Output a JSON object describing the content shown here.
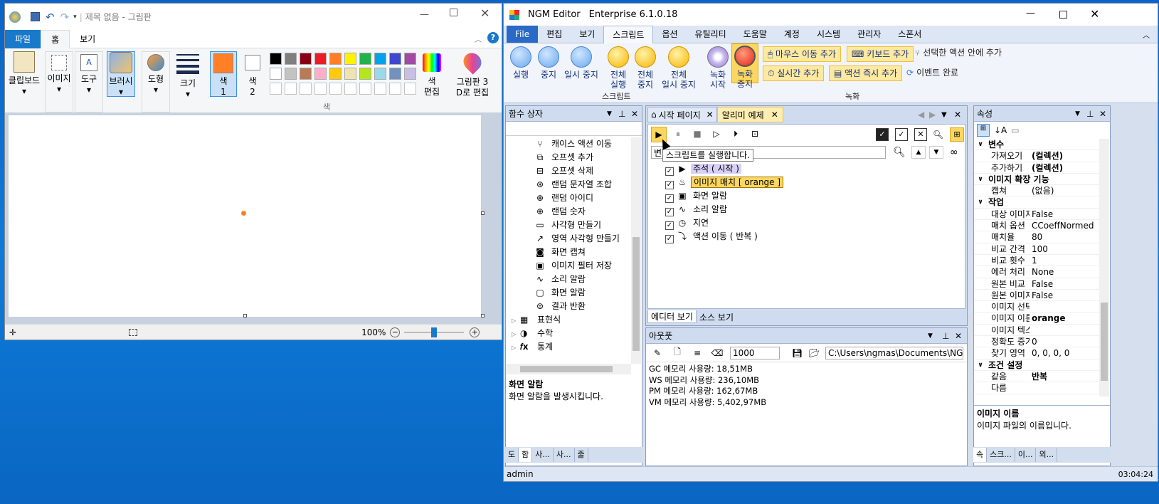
{
  "paint": {
    "title": "제목 없음 - 그림판",
    "tabs": [
      "파일",
      "홈",
      "보기"
    ],
    "groups": {
      "clipboard": "클립보드",
      "image": "이미지",
      "tools": "도구",
      "brushes": "브러시",
      "shapes": "도형",
      "size": "크기",
      "color1": "색",
      "color1_sub": "1",
      "color2": "색",
      "color2_sub": "2",
      "edit_colors": "색",
      "edit_colors_sub": "편집",
      "paint3d": "그림판 3",
      "paint3d_sub": "D로 편집",
      "colors_label": "색"
    },
    "palette_row1": [
      "#000000",
      "#7f7f7f",
      "#880015",
      "#ed1c24",
      "#ff7f27",
      "#fff200",
      "#22b14c",
      "#00a2e8",
      "#3f48cc",
      "#a349a4"
    ],
    "palette_row2": [
      "#ffffff",
      "#c3c3c3",
      "#b97a57",
      "#ffaec9",
      "#ffc90e",
      "#efe4b0",
      "#b5e61d",
      "#99d9ea",
      "#7092be",
      "#c8bfe7"
    ],
    "color1_value": "#ff7f27",
    "zoom": "100%"
  },
  "ngm": {
    "title": "NGM Editor",
    "edition": "Enterprise 6.1.0.18",
    "menu": [
      "File",
      "편집",
      "보기",
      "스크립트",
      "옵션",
      "유틸리티",
      "도움말",
      "계정",
      "시스템",
      "관리자",
      "스폰서"
    ],
    "ribbon": {
      "run": "실행",
      "stop": "중지",
      "pause": "일시 중지",
      "run_all": "전체",
      "run_all_sub": "실행",
      "stop_all": "전체",
      "stop_all_sub": "중지",
      "pause_all": "전체",
      "pause_all_sub": "일시 중지",
      "rec_start": "녹화",
      "rec_start_sub": "시작",
      "rec_stop": "녹화",
      "rec_stop_sub": "중지",
      "mouse_add": "마우스 이동 추가",
      "kbd_add": "키보드 추가",
      "sel_action_add": "선택한 액션 안에 추가",
      "realtime_add": "실시간 추가",
      "immediate_add": "액션 즉시 추가",
      "event_done": "이벤트 완료",
      "group_script": "스크립트",
      "group_record": "녹화"
    },
    "func_box": {
      "title": "함수 상자",
      "items": [
        "캐이스 액션 이동",
        "오프셋 추가",
        "오프셋 삭제",
        "랜덤 문자열 조합",
        "랜덤 아이디",
        "랜덤 숫자",
        "사각형 만들기",
        "영역 사각형 만들기",
        "화면 캡쳐",
        "이미지 필터 저장",
        "소리 알람",
        "화면 알람",
        "결과 반환"
      ],
      "groups": [
        "표현식",
        "수학",
        "통계"
      ],
      "desc_title": "화면 알람",
      "desc": "화면 알람을 발생시킵니다.",
      "bottom_tabs": [
        "도",
        "함",
        "사...",
        "사...",
        "줄"
      ]
    },
    "doc": {
      "tabs": [
        "시작 페이지",
        "알리미 예제"
      ],
      "tooltip": "스크립트를 실행합니다.",
      "search_prefix": "변",
      "rows": [
        "주석 ( 시작 )",
        "이미지 매치 [ orange ]",
        "화면 알람",
        "소리 알람",
        "지연",
        "액션 이동 ( 반복 )"
      ],
      "view_tabs": [
        "에디터 보기",
        "소스 보기"
      ]
    },
    "output": {
      "title": "아웃풋",
      "value": "1000",
      "path": "C:\\Users\\ngmas\\Documents\\NGM6\\",
      "lines": [
        "GC 메모리 사용량: 18,51MB",
        "WS 메모리 사용량: 236,10MB",
        "PM 메모리 사용량: 162,67MB",
        "VM 메모리 사용량: 5,402,97MB"
      ]
    },
    "props": {
      "title": "속성",
      "rows": [
        {
          "k": "변수",
          "v": "",
          "cat": true
        },
        {
          "k": "가져오기",
          "v": "(컬렉션)",
          "bold": true
        },
        {
          "k": "추가하기",
          "v": "(컬렉션)",
          "bold": true
        },
        {
          "k": "이미지 확장 기능",
          "v": "",
          "cat": true
        },
        {
          "k": "캡쳐",
          "v": "(없음)"
        },
        {
          "k": "작업",
          "v": "",
          "cat": true
        },
        {
          "k": "대상 이미지",
          "v": "False"
        },
        {
          "k": "매치 옵션",
          "v": "CCoeffNormed"
        },
        {
          "k": "매치율",
          "v": "80"
        },
        {
          "k": "비교 간격",
          "v": "100"
        },
        {
          "k": "비교 횟수",
          "v": "1"
        },
        {
          "k": "에러 처리",
          "v": "None"
        },
        {
          "k": "원본 비교",
          "v": "False"
        },
        {
          "k": "원본 이미지",
          "v": "False"
        },
        {
          "k": "이미지 선택",
          "v": ""
        },
        {
          "k": "이미지 이름",
          "v": "orange",
          "bold": true
        },
        {
          "k": "이미지 텍스",
          "v": ""
        },
        {
          "k": "정확도 증가",
          "v": "0"
        },
        {
          "k": "찾기 영역",
          "v": "0, 0, 0, 0"
        },
        {
          "k": "조건 설정",
          "v": "",
          "cat": true
        },
        {
          "k": "같음",
          "v": "반복",
          "bold": true
        },
        {
          "k": "다름",
          "v": ""
        }
      ],
      "desc_title": "이미지 이름",
      "desc": "이미지 파일의 이름입니다.",
      "bottom_tabs": [
        "속",
        "스크...",
        "이...",
        "외..."
      ]
    },
    "status_user": "admin",
    "status_time": "03:04:24"
  }
}
